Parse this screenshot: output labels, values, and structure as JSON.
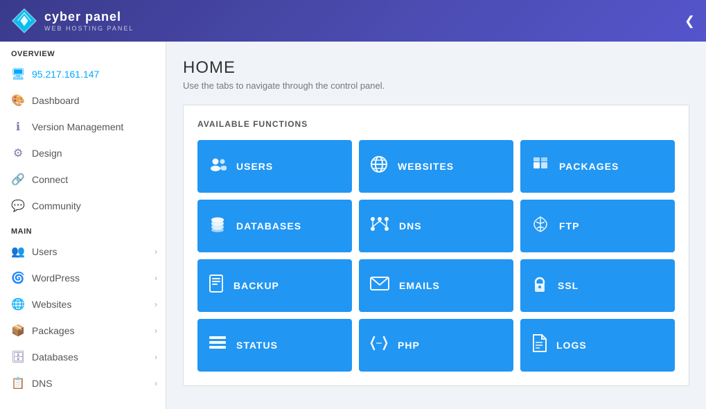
{
  "header": {
    "logo_title": "cyber panel",
    "logo_subtitle": "WEB HOSTING PANEL",
    "toggle_icon": "❮"
  },
  "sidebar": {
    "overview_label": "OVERVIEW",
    "ip_address": "95.217.161.147",
    "overview_items": [
      {
        "id": "dashboard",
        "label": "Dashboard",
        "icon": "🎨"
      },
      {
        "id": "version-management",
        "label": "Version Management",
        "icon": "ℹ"
      },
      {
        "id": "design",
        "label": "Design",
        "icon": "⚙"
      },
      {
        "id": "connect",
        "label": "Connect",
        "icon": "🔗"
      },
      {
        "id": "community",
        "label": "Community",
        "icon": "💬"
      }
    ],
    "main_label": "MAIN",
    "main_items": [
      {
        "id": "users",
        "label": "Users",
        "icon": "👥",
        "has_arrow": true
      },
      {
        "id": "wordpress",
        "label": "WordPress",
        "icon": "🌀",
        "has_arrow": true
      },
      {
        "id": "websites",
        "label": "Websites",
        "icon": "🌐",
        "has_arrow": true
      },
      {
        "id": "packages",
        "label": "Packages",
        "icon": "📦",
        "has_arrow": true
      },
      {
        "id": "databases",
        "label": "Databases",
        "icon": "🗄",
        "has_arrow": true
      },
      {
        "id": "dns",
        "label": "DNS",
        "icon": "📋",
        "has_arrow": true
      }
    ]
  },
  "main": {
    "title": "HOME",
    "subtitle": "Use the tabs to navigate through the control panel.",
    "functions_label": "AVAILABLE FUNCTIONS",
    "functions": [
      {
        "id": "users",
        "label": "USERS",
        "icon": "👥"
      },
      {
        "id": "websites",
        "label": "WEBSITES",
        "icon": "🌐"
      },
      {
        "id": "packages",
        "label": "PACKAGES",
        "icon": "📦"
      },
      {
        "id": "databases",
        "label": "DATABASES",
        "icon": "🗄"
      },
      {
        "id": "dns",
        "label": "DNS",
        "icon": "🔗"
      },
      {
        "id": "ftp",
        "label": "FTP",
        "icon": "☁"
      },
      {
        "id": "backup",
        "label": "BACKUP",
        "icon": "📋"
      },
      {
        "id": "emails",
        "label": "EMAILS",
        "icon": "✉"
      },
      {
        "id": "ssl",
        "label": "SSL",
        "icon": "🔒"
      },
      {
        "id": "status",
        "label": "STATUS",
        "icon": "☰"
      },
      {
        "id": "php",
        "label": "PHP",
        "icon": "⌨"
      },
      {
        "id": "logs",
        "label": "LOGS",
        "icon": "📄"
      }
    ]
  }
}
